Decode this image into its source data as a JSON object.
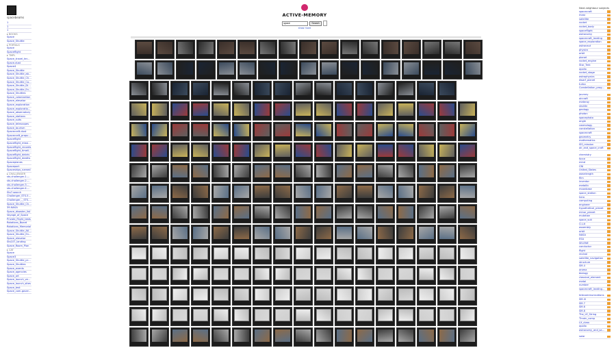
{
  "user": {
    "name": "spacebeams"
  },
  "left_nav": [
    {
      "label": "1"
    },
    {
      "label": "1"
    },
    {
      "label": "1"
    },
    {
      "label": "BOOKS",
      "section": true
    },
    {
      "label": "Space"
    },
    {
      "label": "Space_Shuttle"
    },
    {
      "label": "PORTALS",
      "section": true
    },
    {
      "label": "Space"
    },
    {
      "label": "Spaceflight"
    },
    {
      "label": "TMPL",
      "section": true
    },
    {
      "label": "Space_travel_terminology"
    },
    {
      "label": "Space-dust"
    },
    {
      "label": "Space4"
    },
    {
      "label": "Space_Shuttle"
    },
    {
      "label": "Space_Shuttle_abort"
    },
    {
      "label": "Space_Shuttle_Challenger"
    },
    {
      "label": "Space_Shuttle_Columbia"
    },
    {
      "label": "Space_Shuttle_Discovery"
    },
    {
      "label": "Space_Shuttle_Endeavour"
    },
    {
      "label": "Space_Shuttles"
    },
    {
      "label": "Space_colonization"
    },
    {
      "label": "Space_elevator"
    },
    {
      "label": "Space_exploration"
    },
    {
      "label": "Space_exploration_pol"
    },
    {
      "label": "Space_observatory"
    },
    {
      "label": "Space_stations"
    },
    {
      "label": "Space_suits"
    },
    {
      "label": "Space_telescopes"
    },
    {
      "label": "Space_tourism"
    },
    {
      "label": "Spacecraft-dust"
    },
    {
      "label": "Spacecraft_propulsion"
    },
    {
      "label": "Spaceflight"
    },
    {
      "label": "Spaceflight_missions"
    },
    {
      "label": "Spaceflight_records"
    },
    {
      "label": "Spaceflight_timeline"
    },
    {
      "label": "Spaceflight_debris"
    },
    {
      "label": "Spaceflight_deaths"
    },
    {
      "label": "Spaceplanes"
    },
    {
      "label": "Spaceport"
    },
    {
      "label": "Spaceships_named"
    },
    {
      "label": "CHALLENGER",
      "section": true
    },
    {
      "label": "sts-challenger-1.mp3"
    },
    {
      "label": "sts-challenger-2.mp3"
    },
    {
      "label": "sts-challenger-3.mp3"
    },
    {
      "label": "sts-challenger-4.mp3"
    },
    {
      "label": "Sts7-search"
    },
    {
      "label": "Challenger_STS-51-L_Crew"
    },
    {
      "label": "Challenger_-_STS-51-L_Explosion"
    },
    {
      "label": "Space_Shuttle_Challenger"
    },
    {
      "label": "39-NASA"
    },
    {
      "label": "Space_disaster_list"
    },
    {
      "label": "Voyage_of_Space"
    },
    {
      "label": "Private_Flight_tests"
    },
    {
      "label": "Rotations_Board"
    },
    {
      "label": "Rotations_Memorial"
    },
    {
      "label": "Space_Shuttle_Atlantis"
    },
    {
      "label": "Space_Shuttle_Endeavour"
    },
    {
      "label": "Space_elevator"
    },
    {
      "label": "Sts107_landing"
    },
    {
      "label": "Space_Room_Plan"
    },
    {
      "label": "CAT",
      "section": true
    },
    {
      "label": "Space"
    },
    {
      "label": "Space3"
    },
    {
      "label": "Space_Shuttle_program"
    },
    {
      "label": "Space_Shuttles"
    },
    {
      "label": "Space_events"
    },
    {
      "label": "Space_agencies"
    },
    {
      "label": "Space_art"
    },
    {
      "label": "Space_launch_vehicles"
    },
    {
      "label": "Space_launch_sites"
    },
    {
      "label": "Space_test"
    },
    {
      "label": "Space_com-governmental_orgs"
    }
  ],
  "header": {
    "title": "ACTIVE-MEMORY"
  },
  "search": {
    "value": "space",
    "button_label": "Search",
    "options_link": "show more"
  },
  "grid": {
    "rows": [
      {
        "count": 17,
        "tone": "portrait"
      },
      {
        "count": 17,
        "tone": "craft"
      },
      {
        "count": 16,
        "tone": "craft"
      },
      {
        "count": 17,
        "tone": "patch"
      },
      {
        "count": 17,
        "tone": "patch"
      },
      {
        "count": 17,
        "tone": "patch"
      },
      {
        "count": 17,
        "tone": "photo"
      },
      {
        "count": 17,
        "tone": "photo"
      },
      {
        "count": 17,
        "tone": "photo"
      },
      {
        "count": 17,
        "tone": "photo"
      },
      {
        "count": 17,
        "tone": "glyph"
      },
      {
        "count": 17,
        "tone": "glyph"
      },
      {
        "count": 17,
        "tone": "glyph"
      },
      {
        "count": 17,
        "tone": "glyph"
      },
      {
        "count": 17,
        "tone": "photo"
      }
    ],
    "tones": {
      "portrait": [
        "#3a2f2a",
        "#5b4a40",
        "#777",
        "#2b2b2b"
      ],
      "craft": [
        "#1a2433",
        "#3b4a5c",
        "#8a8f96",
        "#202020"
      ],
      "patch": [
        "#c8b25a",
        "#2a4c8c",
        "#9a3a3a",
        "#5f5f5f"
      ],
      "photo": [
        "#5a6f86",
        "#8d6a48",
        "#3d3d3d",
        "#a8a8a8"
      ],
      "glyph": [
        "#d8d8d8",
        "#bdbdbd",
        "#eeeeee",
        "#cfcfcf"
      ]
    }
  },
  "right_nav": {
    "header": "Next-neighbour subjects",
    "items": [
      "spacecraft",
      "mass",
      "satellite",
      "rocket",
      "rocket_body",
      "spaceflight",
      "astronomy",
      "spacecraft_landing",
      "space_exploration",
      "astronaut",
      "physics",
      "orbit",
      "planet",
      "rocket_engine",
      "Star_Trek",
      "apollo",
      "rocket_stage",
      "astrophysics",
      "dwarf_planet",
      "turbo",
      "Constellation_program",
      "",
      "journey",
      "aircraft",
      "meteroy",
      "shuttle",
      "geology",
      "photon",
      "spacephoto",
      "angle",
      "cosmology",
      "constellation",
      "spacecraft",
      "geometry",
      "mathematics",
      "ISS_mission",
      "air_and_space_craft",
      "",
      "chemistry",
      "force",
      "mind",
      "CNI",
      "United_States",
      "wavelength",
      "film",
      "inventor",
      "metallic",
      "moonbase",
      "space_station",
      "hero",
      "computing",
      "engineer",
      "hypothetical_planet",
      "minor_planet",
      "mutation",
      "space_suit",
      "Cl-Lit",
      "assembly",
      "orbit",
      "NASA",
      "ESA",
      "SELENE",
      "conductor",
      "flight",
      "revival",
      "satellite_navigation",
      "structure",
      "SM-4",
      "aroma",
      "biology",
      "classical_element",
      "metal",
      "number",
      "spacecraft_landing_aid",
      "",
      "telecommunications",
      "SM-III",
      "SM-7",
      "SM-6",
      "SM-8",
      "The_LE_String",
      "Thrain_comp",
      "LX_class",
      "apollo",
      "astronomy_and_satellite",
      "",
      "solar"
    ]
  }
}
